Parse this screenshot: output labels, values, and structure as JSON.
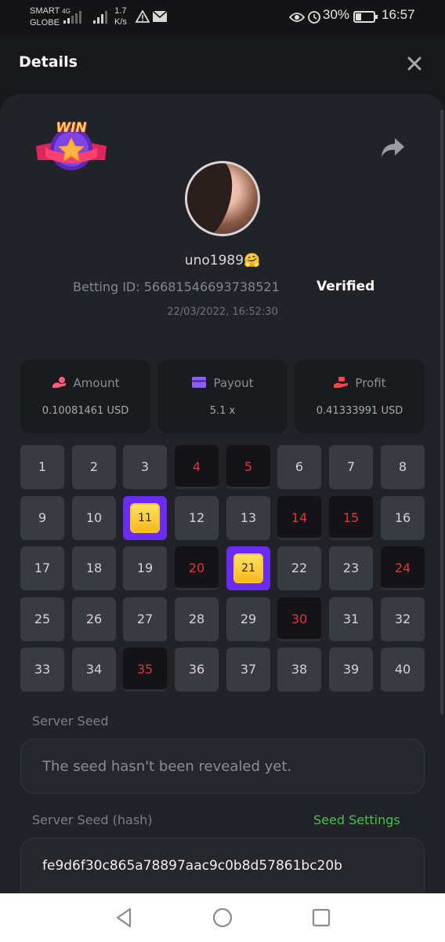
{
  "status_bar": {
    "carrier_line1": "SMART",
    "carrier_line2": "GLOBE",
    "network": "4G",
    "speed_value": "1.7",
    "speed_unit": "K/s",
    "battery": "30%",
    "battery_level": 0.3,
    "time": "16:57",
    "icons": [
      "signal-icon",
      "warning-icon",
      "mail-icon",
      "eye-icon",
      "alarm-icon",
      "battery-icon"
    ]
  },
  "header": {
    "title": "Details",
    "close_icon": "close-icon"
  },
  "bet": {
    "badge_text": "WIN",
    "username": "uno1989🤗",
    "betting_id": "Betting ID: 56681546693738521",
    "verified_label": "Verified",
    "timestamp": "22/03/2022, 16:52:30"
  },
  "stats": [
    {
      "label": "Amount",
      "value": "0.10081461 USD",
      "icon": "coin-hand-icon",
      "color": "#ff5b7a"
    },
    {
      "label": "Payout",
      "value": "5.1 x",
      "icon": "card-icon",
      "color": "#8e5cf7"
    },
    {
      "label": "Profit",
      "value": "0.41333991 USD",
      "icon": "money-hand-icon",
      "color": "#f0464f"
    }
  ],
  "board": {
    "numbers": [
      "1",
      "2",
      "3",
      "4",
      "5",
      "6",
      "7",
      "8",
      "9",
      "10",
      "11",
      "12",
      "13",
      "14",
      "15",
      "16",
      "17",
      "18",
      "19",
      "20",
      "21",
      "22",
      "23",
      "24",
      "25",
      "26",
      "27",
      "28",
      "29",
      "30",
      "31",
      "32",
      "33",
      "34",
      "35",
      "36",
      "37",
      "38",
      "39",
      "40"
    ],
    "picked": [
      "4",
      "5",
      "14",
      "15",
      "20",
      "24",
      "30",
      "35"
    ],
    "hits": [
      "11",
      "21"
    ],
    "colors": {
      "tile": "#3a3b42",
      "picked": "#141418",
      "picked_text": "#e2333b",
      "hit": "#6a2cf0",
      "gem": "#f6c12b"
    }
  },
  "seeds": {
    "server_seed_label": "Server Seed",
    "server_seed_value": "The seed hasn't been revealed yet.",
    "server_hash_label": "Server Seed (hash)",
    "seed_settings_label": "Seed Settings",
    "server_hash_value": "fe9d6f30c865a78897aac9c0b8d57861bc20b"
  },
  "nav_bar": {
    "icons": [
      "back-icon",
      "home-icon",
      "recents-icon"
    ]
  }
}
